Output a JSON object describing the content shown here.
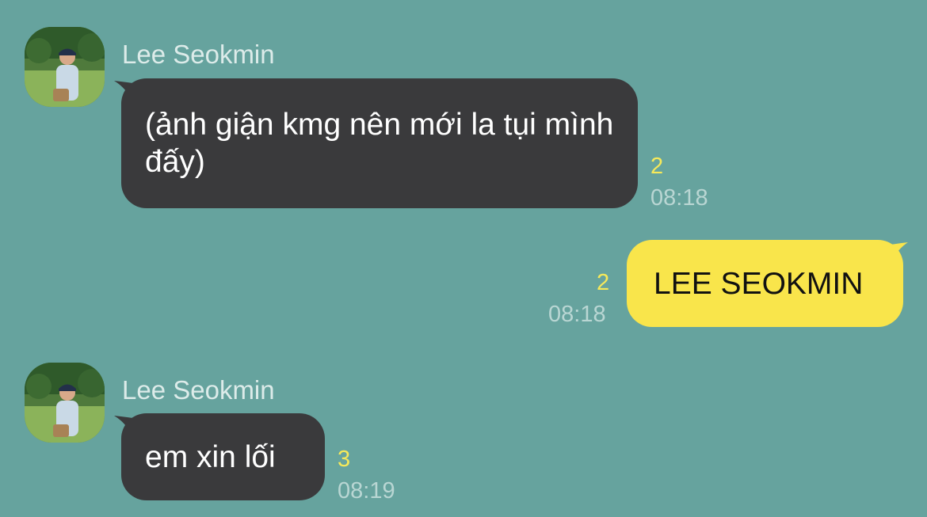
{
  "theme": {
    "background": "#66a39e",
    "incoming_bubble": "#3a3a3c",
    "outgoing_bubble": "#f9e54b",
    "unread_count_color": "#f6e95a",
    "time_color": "#b9d6d3"
  },
  "messages": [
    {
      "direction": "incoming",
      "sender": "Lee Seokmin",
      "text": "(ảnh giận kmg nên mới la tụi mình đấy)",
      "unread_count": "2",
      "time": "08:18"
    },
    {
      "direction": "outgoing",
      "text": "LEE SEOKMIN",
      "unread_count": "2",
      "time": "08:18"
    },
    {
      "direction": "incoming",
      "sender": "Lee Seokmin",
      "text": "em xin lối",
      "unread_count": "3",
      "time": "08:19"
    }
  ]
}
